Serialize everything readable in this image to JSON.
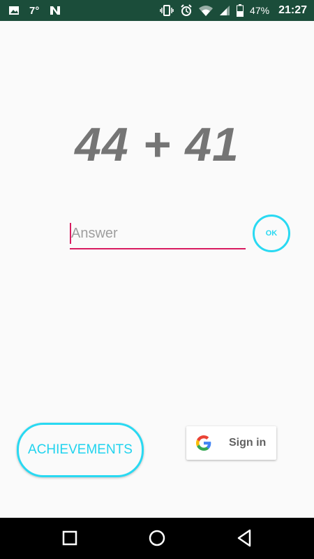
{
  "status_bar": {
    "temperature": "7°",
    "battery_percent": "47%",
    "time": "21:27",
    "icons": [
      "image-icon",
      "n-app-icon",
      "vibrate-icon",
      "alarm-icon",
      "wifi-icon",
      "signal-icon",
      "battery-icon"
    ]
  },
  "game": {
    "equation": "44 + 41"
  },
  "answer": {
    "placeholder": "Answer",
    "value": ""
  },
  "ok_button": {
    "label": "OK"
  },
  "achievements_button": {
    "label": "ACHIEVEMENTS"
  },
  "signin_button": {
    "label": "Sign in",
    "icon": "google-icon"
  },
  "nav_bar": {
    "buttons": [
      "recents-icon",
      "home-icon",
      "back-icon"
    ]
  },
  "colors": {
    "status_bar_bg": "#1b4d3a",
    "accent_cyan": "#29d9f2",
    "input_underline": "#d81b60",
    "equation_text": "#757575"
  }
}
